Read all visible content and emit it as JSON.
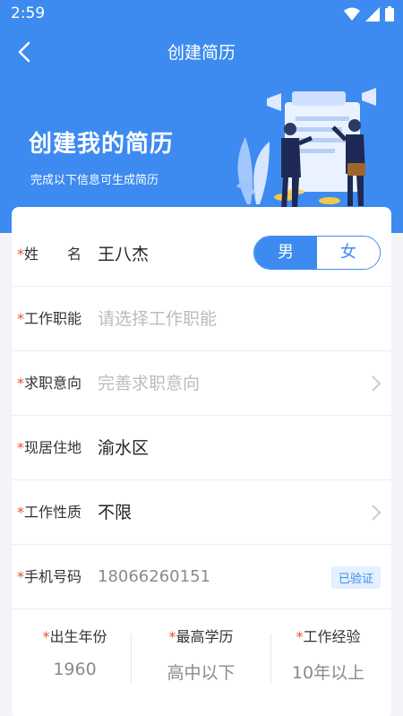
{
  "status": {
    "time": "2:59"
  },
  "nav": {
    "title": "创建简历"
  },
  "hero": {
    "title": "创建我的简历",
    "subtitle": "完成以下信息可生成简历"
  },
  "colors": {
    "primary": "#3d8bf0",
    "required": "#e8522c"
  },
  "form": {
    "name": {
      "label": "姓　　名",
      "value": "王八杰"
    },
    "gender": {
      "male": "男",
      "female": "女",
      "selected": "男"
    },
    "job_function": {
      "label": "工作职能",
      "placeholder": "请选择工作职能"
    },
    "job_intent": {
      "label": "求职意向",
      "placeholder": "完善求职意向"
    },
    "residence": {
      "label": "现居住地",
      "value": "渝水区"
    },
    "job_nature": {
      "label": "工作性质",
      "value": "不限"
    },
    "phone": {
      "label": "手机号码",
      "value": "18066260151",
      "badge": "已验证"
    },
    "birth_year": {
      "label": "出生年份",
      "value": "1960"
    },
    "education": {
      "label": "最高学历",
      "value": "高中以下"
    },
    "experience": {
      "label": "工作经验",
      "value": "10年以上"
    }
  },
  "required_mark": "*"
}
